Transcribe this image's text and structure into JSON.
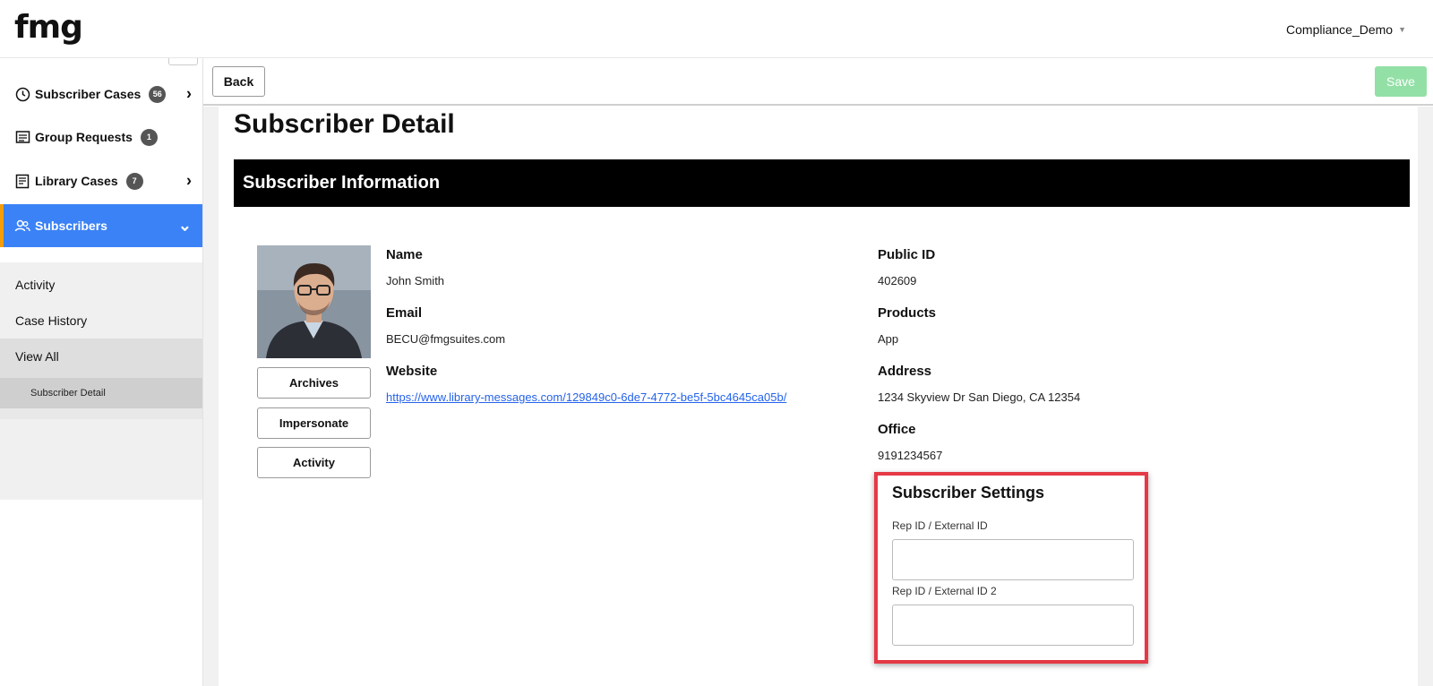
{
  "app": {
    "logo": "fmg",
    "account_name": "Compliance_Demo"
  },
  "sidebar": {
    "items": [
      {
        "label": "Subscriber Cases",
        "badge": "56",
        "icon": "circle-clock-icon"
      },
      {
        "label": "Group Requests",
        "badge": "1",
        "icon": "list-doc-icon"
      },
      {
        "label": "Library Cases",
        "badge": "7",
        "icon": "library-list-icon"
      },
      {
        "label": "Subscribers",
        "icon": "users-icon"
      }
    ],
    "subitems": [
      {
        "label": "Activity"
      },
      {
        "label": "Case History"
      },
      {
        "label": "View All"
      }
    ],
    "subsub_label": "Subscriber Detail"
  },
  "toolbar": {
    "back_label": "Back",
    "save_label": "Save"
  },
  "page": {
    "title": "Subscriber Detail",
    "section_title": "Subscriber Information"
  },
  "profile_buttons": [
    "Archives",
    "Impersonate",
    "Activity"
  ],
  "details": {
    "name_label": "Name",
    "name_value": "John Smith",
    "email_label": "Email",
    "email_value": "BECU@fmgsuites.com",
    "website_label": "Website",
    "website_value": "https://www.library-messages.com/129849c0-6de7-4772-be5f-5bc4645ca05b/",
    "public_id_label": "Public ID",
    "public_id_value": "402609",
    "products_label": "Products",
    "products_value": "App",
    "address_label": "Address",
    "address_value": "1234 Skyview Dr San Diego, CA 12354",
    "office_label": "Office",
    "office_value": "9191234567"
  },
  "settings": {
    "title": "Subscriber Settings",
    "rep_id_label": "Rep ID / External ID",
    "rep_id_value": "",
    "rep_id2_label": "Rep ID / External ID 2",
    "rep_id2_value": ""
  },
  "colors": {
    "active_nav": "#3b82f6",
    "active_accent": "#f59e0b",
    "save_disabled": "#93e0a6",
    "highlight": "#e53946",
    "link": "#2563eb"
  }
}
